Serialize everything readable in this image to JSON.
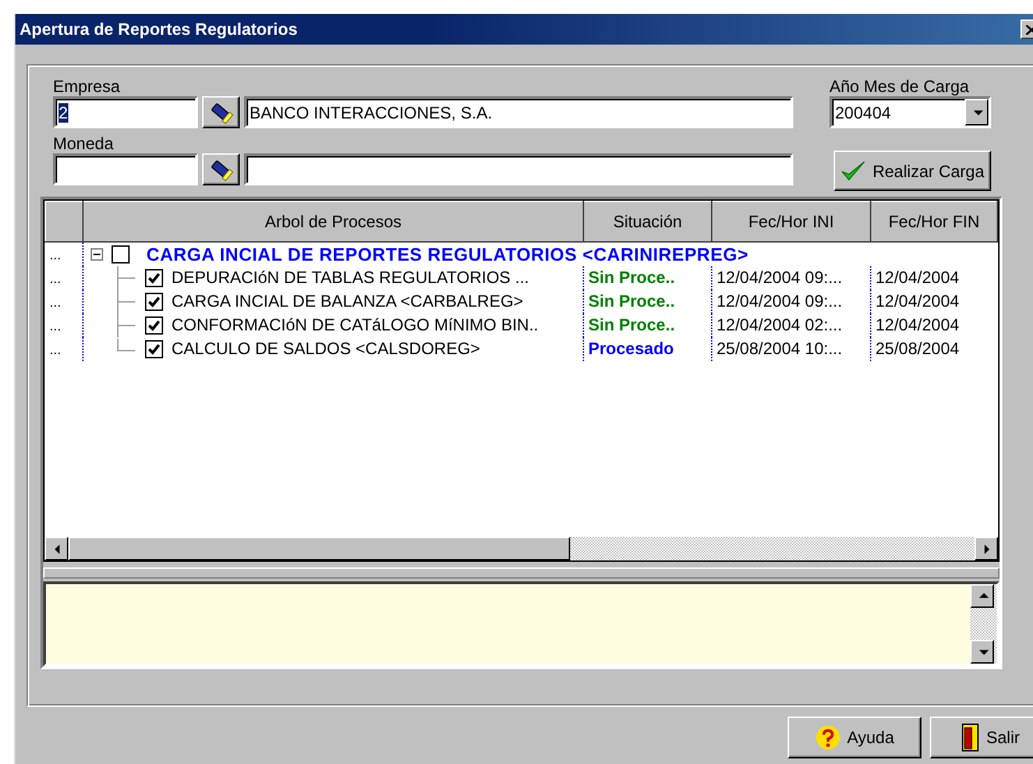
{
  "window": {
    "title": "Apertura de Reportes Regulatorios"
  },
  "form": {
    "empresa": {
      "label": "Empresa",
      "code": "2",
      "code_selected": true,
      "name": "BANCO INTERACCIONES, S.A."
    },
    "moneda": {
      "label": "Moneda"
    },
    "periodo": {
      "label": "Año Mes de Carga",
      "value": "200404"
    },
    "load_button": "Realizar Carga"
  },
  "grid": {
    "columns": [
      "Arbol de Procesos",
      "Situación",
      "Fec/Hor INI",
      "Fec/Hor FIN"
    ],
    "rows": [
      {
        "marker": "...",
        "label": "CARGA INCIAL DE REPORTES REGULATORIOS  <CARINIREPREG>",
        "checked": false,
        "expanded": true,
        "children": [
          {
            "marker": "...",
            "label": "DEPURACIóN DE TABLAS REGULATORIOS  ...",
            "checked": true,
            "status": "Sin Proce..",
            "color": "#008000",
            "start": "12/04/2004 09:...",
            "end": "12/04/2004"
          },
          {
            "marker": "...",
            "label": "CARGA INCIAL DE BALANZA  <CARBALREG>",
            "checked": true,
            "status": "Sin Proce..",
            "color": "#008000",
            "start": "12/04/2004 09:...",
            "end": "12/04/2004"
          },
          {
            "marker": "...",
            "label": "CONFORMACIóN DE CATáLOGO MíNIMO BIN..",
            "checked": true,
            "status": "Sin Proce..",
            "color": "#008000",
            "start": "12/04/2004 02:...",
            "end": "12/04/2004"
          },
          {
            "marker": "...",
            "label": "CALCULO DE SALDOS  <CALSDOREG>",
            "checked": true,
            "status": "Procesado",
            "color": "#0000ff",
            "start": "25/08/2004 10:...",
            "end": "25/08/2004"
          }
        ]
      }
    ]
  },
  "buttons": [
    {
      "kind": "help",
      "label": "Ayuda"
    },
    {
      "kind": "exit",
      "label": "Salir"
    }
  ]
}
